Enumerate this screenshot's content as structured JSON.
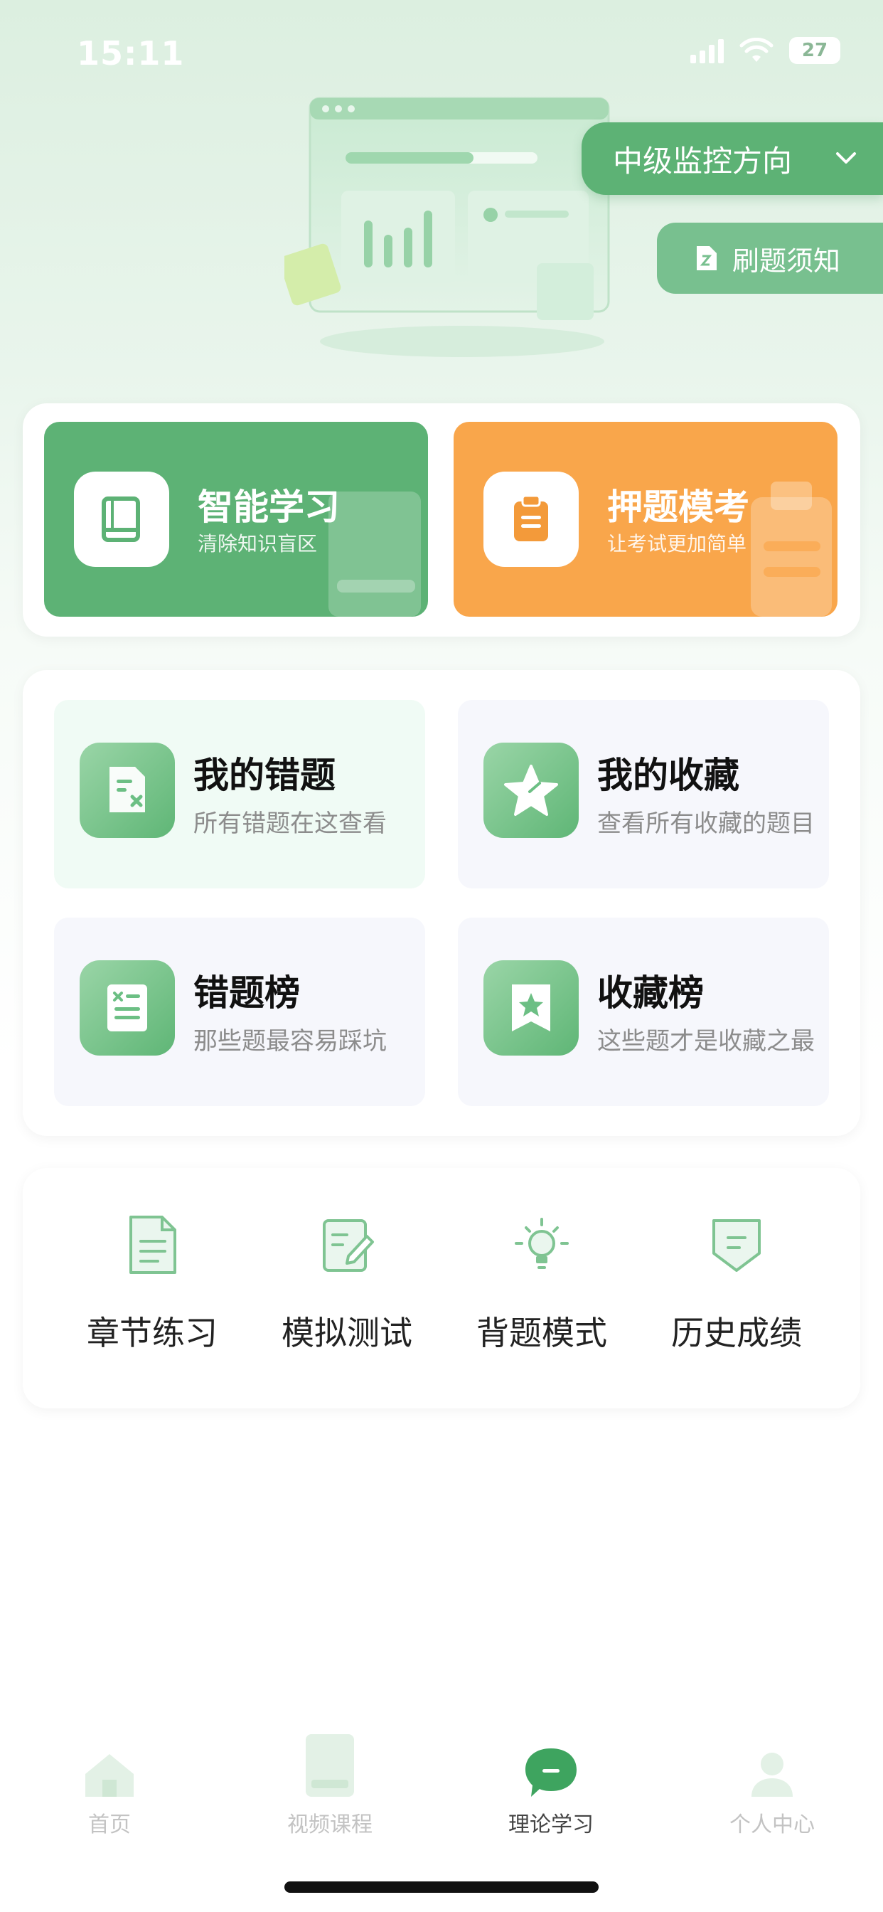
{
  "status_bar": {
    "time": "15:11",
    "battery": "27"
  },
  "header": {
    "direction_label": "中级监控方向",
    "notice_label": "刷题须知"
  },
  "features": [
    {
      "title": "智能学习",
      "subtitle": "清除知识盲区",
      "color": "#5db275",
      "icon": "book-icon"
    },
    {
      "title": "押题模考",
      "subtitle": "让考试更加简单",
      "color": "#f9a64b",
      "icon": "clipboard-icon"
    }
  ],
  "my_area": [
    {
      "title": "我的错题",
      "subtitle": "所有错题在这查看",
      "icon": "wrong-note-icon"
    },
    {
      "title": "我的收藏",
      "subtitle": "查看所有收藏的题目",
      "icon": "star-icon"
    },
    {
      "title": "错题榜",
      "subtitle": "那些题最容易踩坑",
      "icon": "error-list-icon"
    },
    {
      "title": "收藏榜",
      "subtitle": "这些题才是收藏之最",
      "icon": "bookmark-star-icon"
    }
  ],
  "tools": [
    {
      "label": "章节练习",
      "icon": "document-icon"
    },
    {
      "label": "模拟测试",
      "icon": "edit-icon"
    },
    {
      "label": "背题模式",
      "icon": "bulb-icon"
    },
    {
      "label": "历史成绩",
      "icon": "shield-icon"
    }
  ],
  "tabs": [
    {
      "label": "首页",
      "icon": "home-icon",
      "active": false
    },
    {
      "label": "视频课程",
      "icon": "video-book-icon",
      "active": false
    },
    {
      "label": "理论学习",
      "icon": "chat-icon",
      "active": true
    },
    {
      "label": "个人中心",
      "icon": "user-icon",
      "active": false
    }
  ],
  "colors": {
    "accent": "#5db275",
    "orange": "#f9a64b",
    "light_green": "#78c08f"
  }
}
